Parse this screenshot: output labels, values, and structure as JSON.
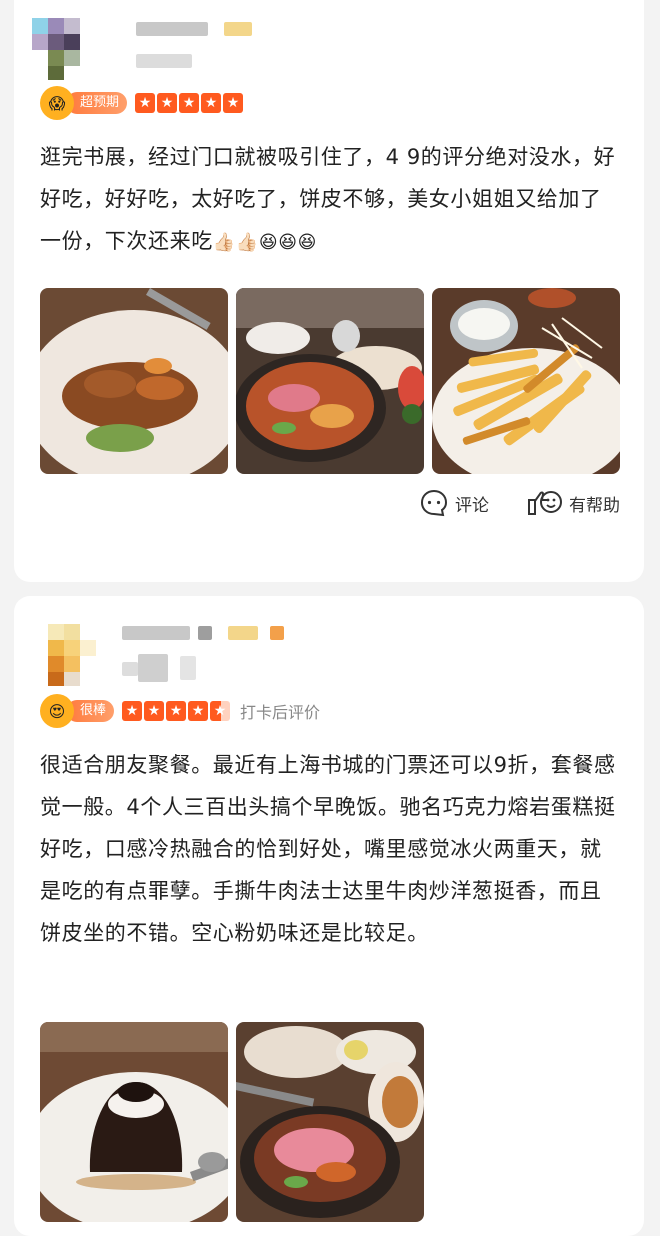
{
  "reviews": [
    {
      "badge": {
        "emoji": "😱",
        "label": "超预期"
      },
      "rating": 5,
      "stars": [
        "★",
        "★",
        "★",
        "★",
        "★"
      ],
      "text": "逛完书展，经过门口就被吸引住了，4 9的评分绝对没水，好好吃，好好吃，太好吃了，饼皮不够，美女小姐姐又给加了一份，下次还来吃",
      "emojis": "👍🏻👍🏻😆😆😆",
      "actions": {
        "comment_label": "评论",
        "helpful_label": "有帮助"
      }
    },
    {
      "badge": {
        "emoji": "😍",
        "label": "很棒"
      },
      "rating": 4.5,
      "stars": [
        "★",
        "★",
        "★",
        "★",
        "★"
      ],
      "after_label": "打卡后评价",
      "text": "很适合朋友聚餐。最近有上海书城的门票还可以9折，套餐感觉一般。4个人三百出头搞个早晚饭。驰名巧克力熔岩蛋糕挺好吃，口感冷热融合的恰到好处，嘴里感觉冰火两重天，就是吃的有点罪孽。手撕牛肉法士达里牛肉炒洋葱挺香，而且饼皮坐的不错。空心粉奶味还是比较足。"
    }
  ],
  "colors": {
    "accent": "#ff5a1f",
    "pill": "#ff7a3d",
    "background": "#f3f3f3"
  },
  "icons": [
    "comment-icon",
    "thumbs-up-icon"
  ]
}
